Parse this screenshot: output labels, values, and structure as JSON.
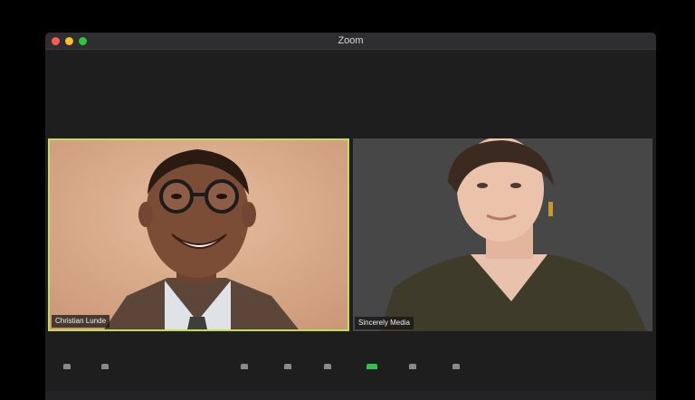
{
  "window": {
    "title": "Zoom"
  },
  "participants": [
    {
      "name": "Christian Lunde",
      "active_speaker": true
    },
    {
      "name": "Sincerely Media",
      "active_speaker": false
    }
  ],
  "colors": {
    "active_speaker_border": "#c3dd55",
    "traffic_close": "#fd5b55",
    "traffic_minimize": "#fdbb2e",
    "traffic_maximize": "#2ac840"
  },
  "toolbar": {
    "icons": [
      "mute-mic-icon",
      "video-icon",
      "security-icon",
      "participants-icon",
      "chat-icon",
      "share-screen-icon",
      "record-icon",
      "reactions-icon"
    ]
  }
}
